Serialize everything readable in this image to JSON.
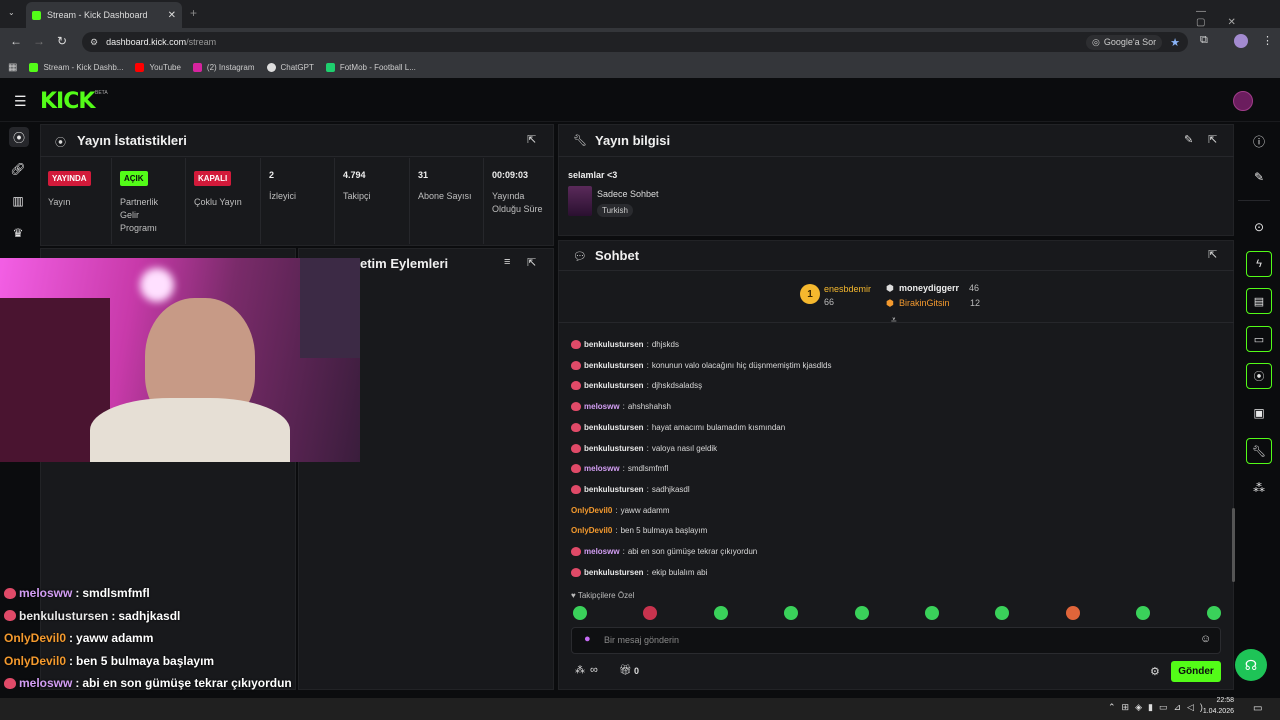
{
  "browser": {
    "tab_title": "Stream - Kick Dashboard",
    "url_host": "dashboard.kick.com",
    "url_path": "/stream",
    "google_label": "Google'a Sor",
    "bookmarks": [
      "Stream - Kick Dashb...",
      "YouTube",
      "(2) Instagram",
      "ChatGPT",
      "FotMob - Football L..."
    ]
  },
  "stats": {
    "title": "Yayın İstatistikleri",
    "items": [
      {
        "badge": "YAYINDA",
        "badge_color": "#d21a3a",
        "label": "Yayın"
      },
      {
        "badge": "AÇIK",
        "badge_color": "#53fc18",
        "label": "Partnerlik Gelir Programı"
      },
      {
        "badge": "KAPALI",
        "badge_color": "#d21a3a",
        "label": "Çoklu Yayın"
      },
      {
        "value": "2",
        "label": "İzleyici"
      },
      {
        "value": "4.794",
        "label": "Takipçi"
      },
      {
        "value": "31",
        "label": "Abone Sayısı"
      },
      {
        "value": "00:09:03",
        "label": "Yayında Olduğu Süre"
      }
    ]
  },
  "actions": {
    "title": "etim Eylemleri"
  },
  "info": {
    "title": "Yayın bilgisi",
    "stream_title": "selamlar <3",
    "category": "Sadece Sohbet",
    "language": "Turkish"
  },
  "chat": {
    "title": "Sohbet",
    "leaderboard": [
      {
        "rank": "1",
        "name": "enesbdemir",
        "count": "66"
      },
      {
        "name": "moneydiggerr",
        "count": "46"
      },
      {
        "name": "BirakinGitsin",
        "count": "12"
      }
    ],
    "messages": [
      {
        "user": "benkulustursen",
        "style": "nb",
        "badge": true,
        "text": "dhjskds"
      },
      {
        "user": "benkulustursen",
        "style": "nb",
        "badge": true,
        "text": "konunun valo olacağını hiç düşnmemiştim kjasdlds"
      },
      {
        "user": "benkulustursen",
        "style": "nb",
        "badge": true,
        "text": "djhskdsaladsş"
      },
      {
        "user": "melosww",
        "style": "np",
        "badge": true,
        "text": "ahshshahsh"
      },
      {
        "user": "benkulustursen",
        "style": "nb",
        "badge": true,
        "text": "hayat amacımı bulamadım kısmından"
      },
      {
        "user": "benkulustursen",
        "style": "nb",
        "badge": true,
        "text": "valoya nasıl geldik"
      },
      {
        "user": "melosww",
        "style": "np",
        "badge": true,
        "text": "smdlsmfmfl"
      },
      {
        "user": "benkulustursen",
        "style": "nb",
        "badge": true,
        "text": "sadhjkasdl"
      },
      {
        "user": "OnlyDevil0",
        "style": "no",
        "badge": false,
        "text": "yaww adamm"
      },
      {
        "user": "OnlyDevil0",
        "style": "no",
        "badge": false,
        "text": "ben 5 bulmaya başlayım"
      },
      {
        "user": "melosww",
        "style": "np",
        "badge": true,
        "text": "abi en son gümüşe tekrar çıkıyordun"
      },
      {
        "user": "benkulustursen",
        "style": "nb",
        "badge": true,
        "text": "ekip bulalım abi"
      }
    ],
    "followers_only": "Takipçilere Özel",
    "input_placeholder": "Bir mesaj gönderin",
    "send_label": "Gönder",
    "points": "∞",
    "gift_count": "0"
  },
  "overlay_messages": [
    {
      "user": "melosww",
      "style": "np",
      "text": "smdlsmfmfl"
    },
    {
      "user": "benkulustursen",
      "style": "nb",
      "text": "sadhjkasdl"
    },
    {
      "user": "OnlyDevil0",
      "style": "no",
      "text": "yaww adamm"
    },
    {
      "user": "OnlyDevil0",
      "style": "no",
      "text": "ben 5 bulmaya başlayım"
    },
    {
      "user": "melosww",
      "style": "np",
      "text": "abi en son gümüşe tekrar çıkıyordun"
    },
    {
      "user": "benkulustursen",
      "style": "nb",
      "text": "ekip bulalım abi"
    }
  ],
  "taskbar": {
    "time": "22:58",
    "date": "1.04.2026"
  },
  "colors": {
    "accent": "#53fc18",
    "live": "#d21a3a",
    "panel": "#18191c"
  }
}
